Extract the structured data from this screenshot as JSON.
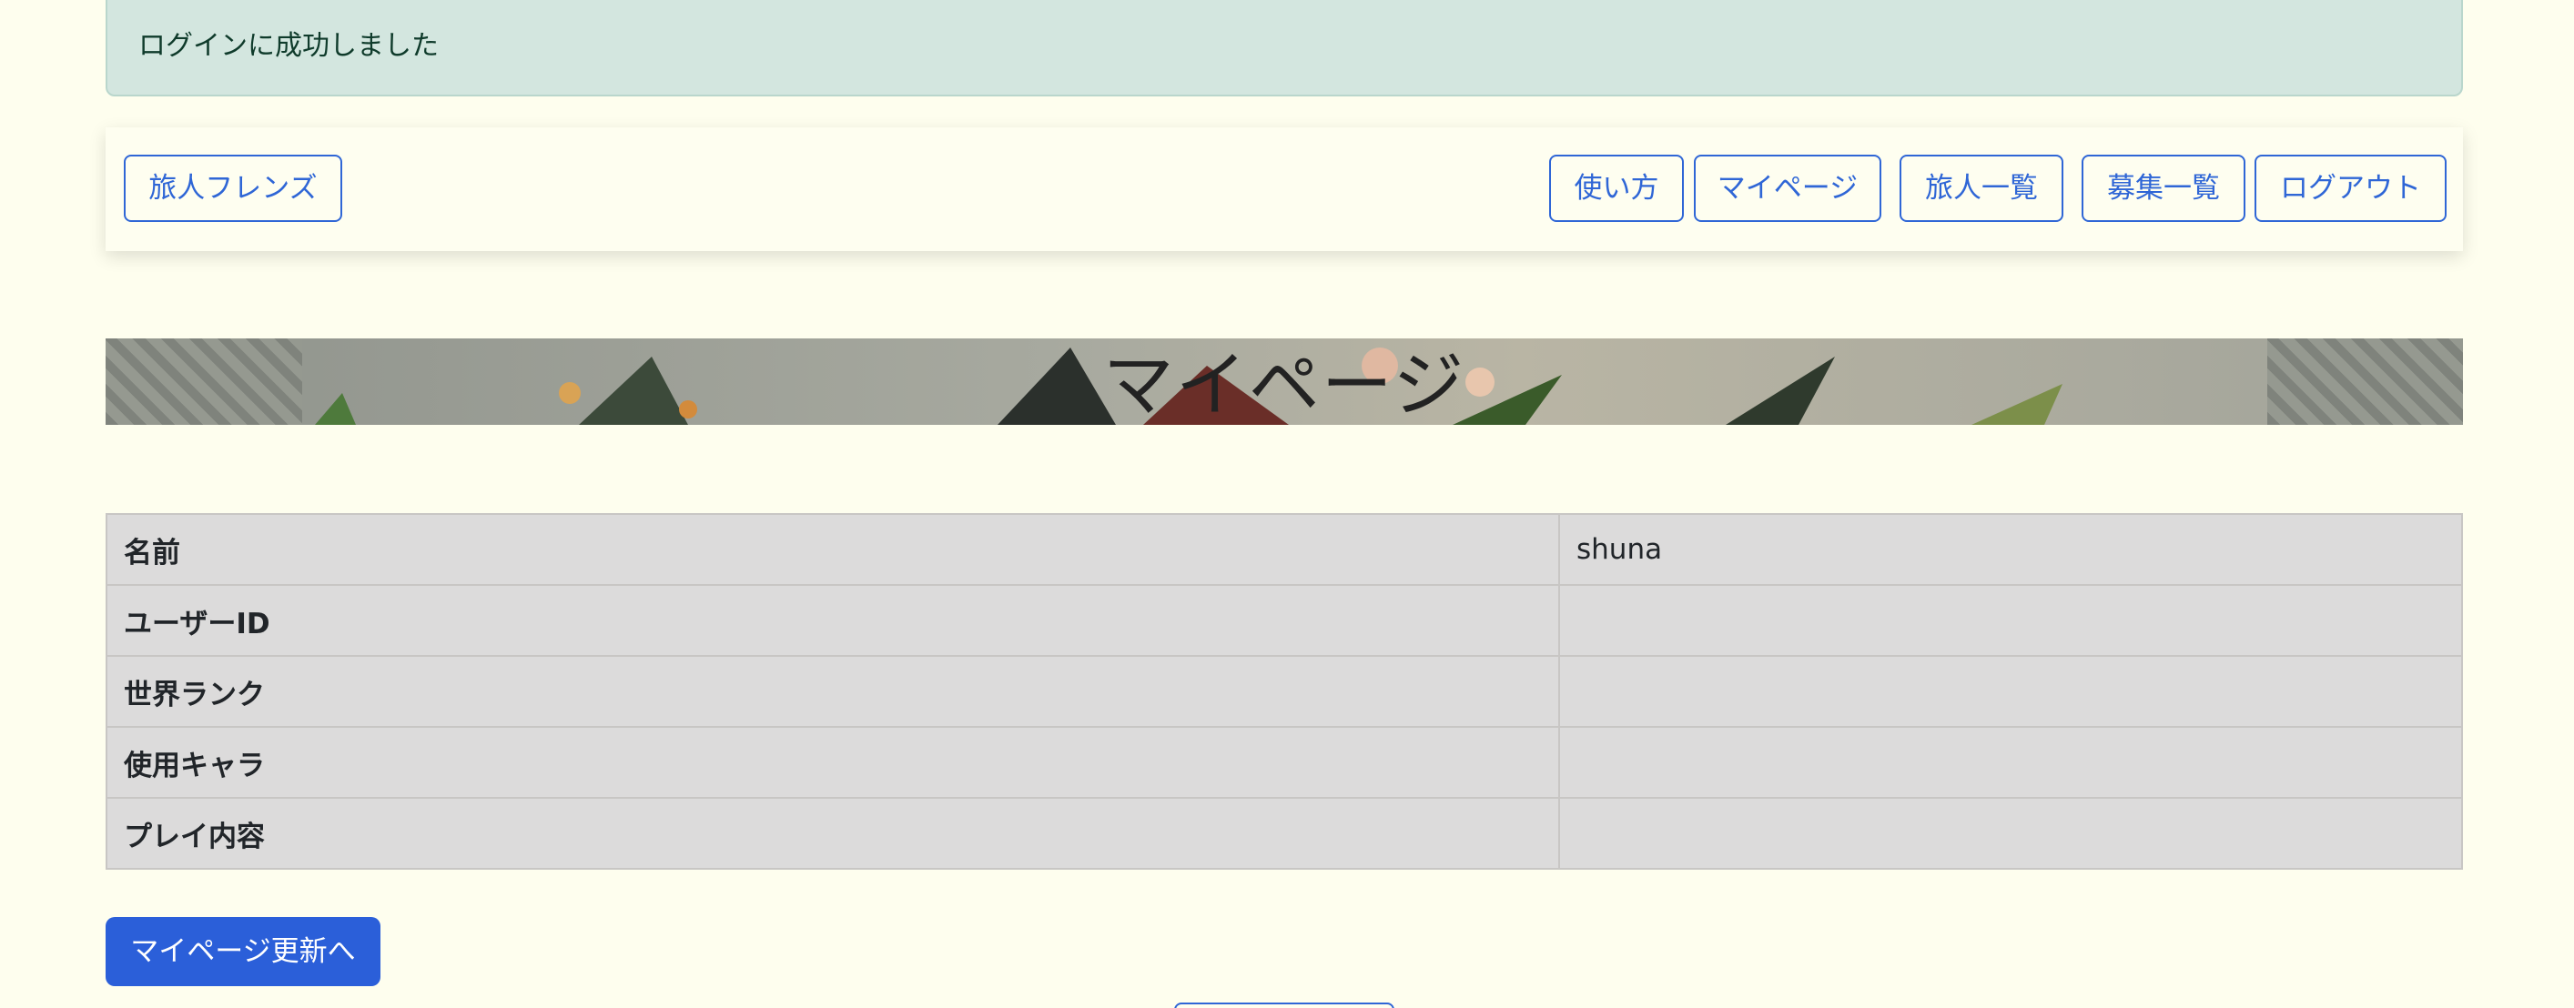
{
  "flash": {
    "message": "ログインに成功しました"
  },
  "navbar": {
    "brand": "旅人フレンズ",
    "links": {
      "usage": "使い方",
      "mypage": "マイページ",
      "travelers": "旅人一覧",
      "recruitments": "募集一覧",
      "logout": "ログアウト"
    }
  },
  "hero": {
    "title": "マイページ"
  },
  "profile": {
    "rows": [
      {
        "label": "名前",
        "value": "shuna"
      },
      {
        "label": "ユーザーID",
        "value": ""
      },
      {
        "label": "世界ランク",
        "value": ""
      },
      {
        "label": "使用キャラ",
        "value": ""
      },
      {
        "label": "プレイ内容",
        "value": ""
      }
    ]
  },
  "actions": {
    "update_label": "マイページ更新へ"
  },
  "colors": {
    "background": "#fefeee",
    "primary": "#2b5fd9",
    "outline": "#2f66d6",
    "alert_bg": "#d3e6df"
  }
}
